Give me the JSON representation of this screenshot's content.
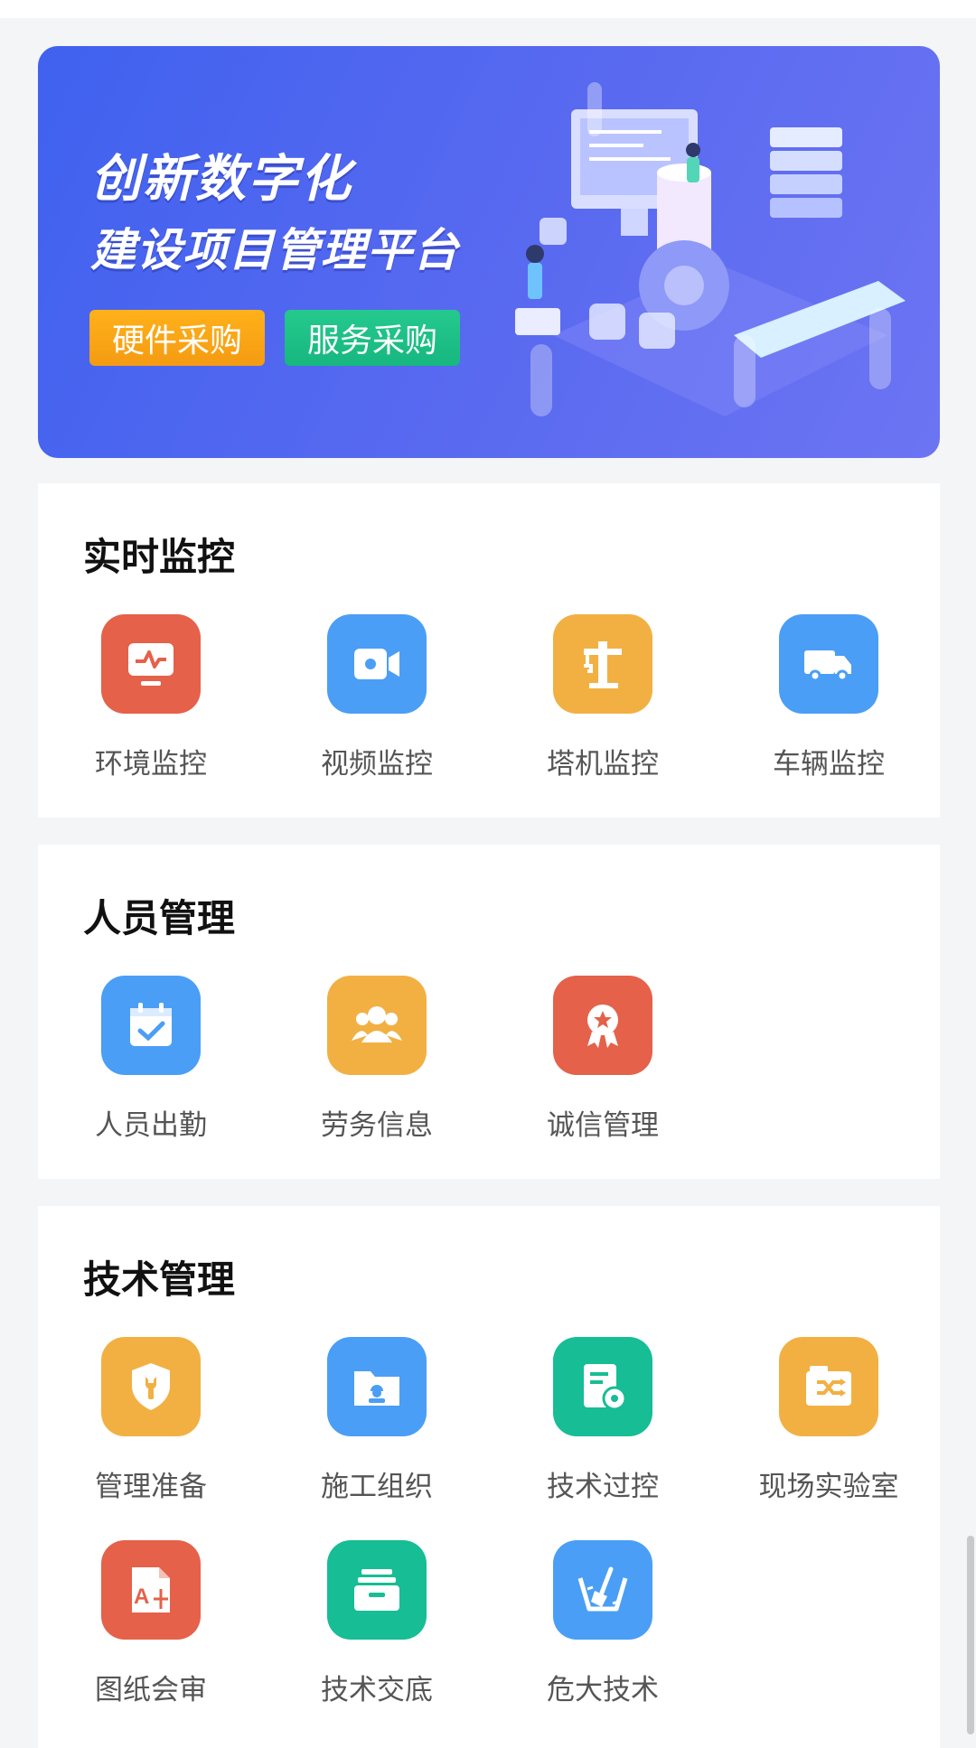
{
  "banner": {
    "title_line1": "创新数字化",
    "title_line2": "建设项目管理平台",
    "buttons": {
      "hardware": "硬件采购",
      "service": "服务采购"
    }
  },
  "sections": {
    "monitor": {
      "title": "实时监控",
      "items": [
        {
          "label": "环境监控",
          "icon": "environment-monitor-icon",
          "color": "#e5614a"
        },
        {
          "label": "视频监控",
          "icon": "video-camera-icon",
          "color": "#4a9ef5"
        },
        {
          "label": "塔机监控",
          "icon": "tower-crane-icon",
          "color": "#f2b043"
        },
        {
          "label": "车辆监控",
          "icon": "truck-icon",
          "color": "#4a9ef5"
        }
      ]
    },
    "personnel": {
      "title": "人员管理",
      "items": [
        {
          "label": "人员出勤",
          "icon": "calendar-check-icon",
          "color": "#4a9ef5"
        },
        {
          "label": "劳务信息",
          "icon": "group-people-icon",
          "color": "#f2b043"
        },
        {
          "label": "诚信管理",
          "icon": "award-badge-icon",
          "color": "#e5614a"
        }
      ]
    },
    "technical": {
      "title": "技术管理",
      "items": [
        {
          "label": "管理准备",
          "icon": "shield-wrench-icon",
          "color": "#f2b043"
        },
        {
          "label": "施工组织",
          "icon": "folder-worker-icon",
          "color": "#4a9ef5"
        },
        {
          "label": "技术过控",
          "icon": "document-gear-icon",
          "color": "#17bd94"
        },
        {
          "label": "现场实验室",
          "icon": "shuffle-folder-icon",
          "color": "#f2b043"
        },
        {
          "label": "图纸会审",
          "icon": "drawing-file-icon",
          "color": "#e5614a"
        },
        {
          "label": "技术交底",
          "icon": "archive-box-icon",
          "color": "#17bd94"
        },
        {
          "label": "危大技术",
          "icon": "excavation-shovel-icon",
          "color": "#4a9ef5"
        }
      ]
    }
  }
}
